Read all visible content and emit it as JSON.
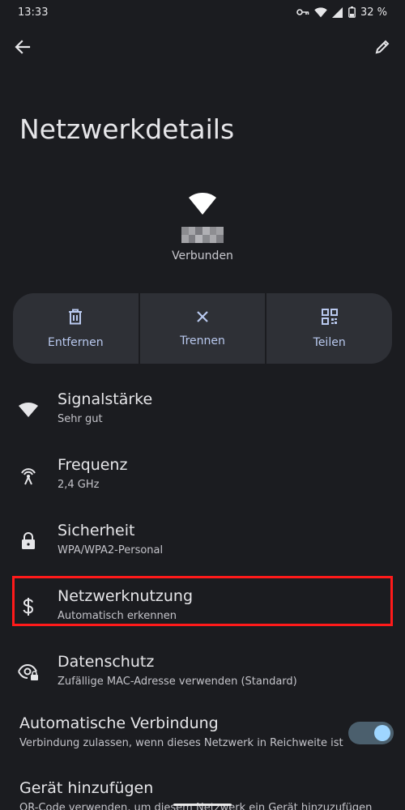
{
  "status_bar": {
    "time": "13:33",
    "battery": "32 %",
    "icons": [
      "vpn-key-icon",
      "wifi-icon",
      "signal-icon",
      "battery-icon"
    ]
  },
  "app_bar": {
    "back_icon": "arrow-back-icon",
    "edit_icon": "pencil-icon"
  },
  "page": {
    "title": "Netzwerkdetails"
  },
  "network": {
    "icon": "wifi-icon",
    "status": "Verbunden"
  },
  "actions": [
    {
      "label": "Entfernen",
      "icon": "trash-icon"
    },
    {
      "label": "Trennen",
      "icon": "close-icon"
    },
    {
      "label": "Teilen",
      "icon": "qr-code-icon"
    }
  ],
  "details": [
    {
      "title": "Signalstärke",
      "value": "Sehr gut",
      "icon": "wifi-icon"
    },
    {
      "title": "Frequenz",
      "value": "2,4 GHz",
      "icon": "antenna-icon"
    },
    {
      "title": "Sicherheit",
      "value": "WPA/WPA2-Personal",
      "icon": "lock-icon"
    },
    {
      "title": "Netzwerknutzung",
      "value": "Automatisch erkennen",
      "icon": "dollar-icon"
    },
    {
      "title": "Datenschutz",
      "value": "Zufällige MAC-Adresse verwenden (Standard)",
      "icon": "privacy-eye-icon"
    }
  ],
  "auto_connect": {
    "title": "Automatische Verbindung",
    "subtitle": "Verbindung zulassen, wenn dieses Netzwerk in Reichweite ist",
    "enabled": true
  },
  "add_device": {
    "title": "Gerät hinzufügen",
    "subtitle": "QR-Code verwenden, um diesem Netzwerk ein Gerät hinzuzufügen"
  },
  "colors": {
    "background": "#1b1c20",
    "card": "#2e3036",
    "accent_text": "#b9c9ef",
    "highlight": "#ff1a1a",
    "switch_track": "#4b5f6d",
    "switch_thumb": "#9fd6ff"
  }
}
